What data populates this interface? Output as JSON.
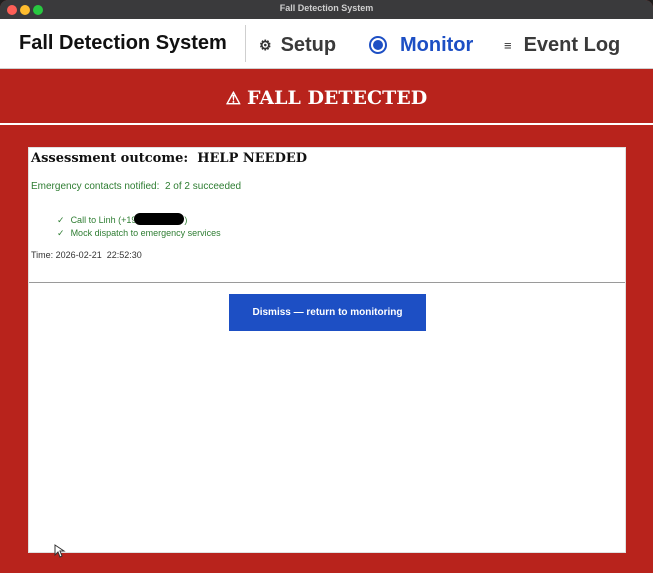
{
  "window": {
    "title": "Fall Detection System"
  },
  "nav": {
    "app_name": "Fall Detection System",
    "items": [
      {
        "label": "Setup",
        "icon": "gear-icon"
      },
      {
        "label": "Monitor",
        "icon": "radio-selected-icon",
        "active": true
      },
      {
        "label": "Event Log",
        "icon": "list-icon"
      }
    ]
  },
  "banner": {
    "text": "FALL DETECTED",
    "icon": "warning-icon"
  },
  "panel": {
    "outcome": "Assessment outcome:  HELP NEEDED",
    "contacts": "Emergency contacts notified:  2 of 2 succeeded",
    "checks": [
      {
        "text": "Call to Linh (+19",
        "suffix": ")"
      },
      {
        "text": "Mock dispatch to emergency services"
      }
    ],
    "time": "Time: 2026-02-21  22:52:30",
    "dismiss_label": "Dismiss — return to monitoring"
  },
  "colors": {
    "alert_red": "#b8231c",
    "accent_blue": "#1d4fc4",
    "success_green": "#2e7d32"
  }
}
